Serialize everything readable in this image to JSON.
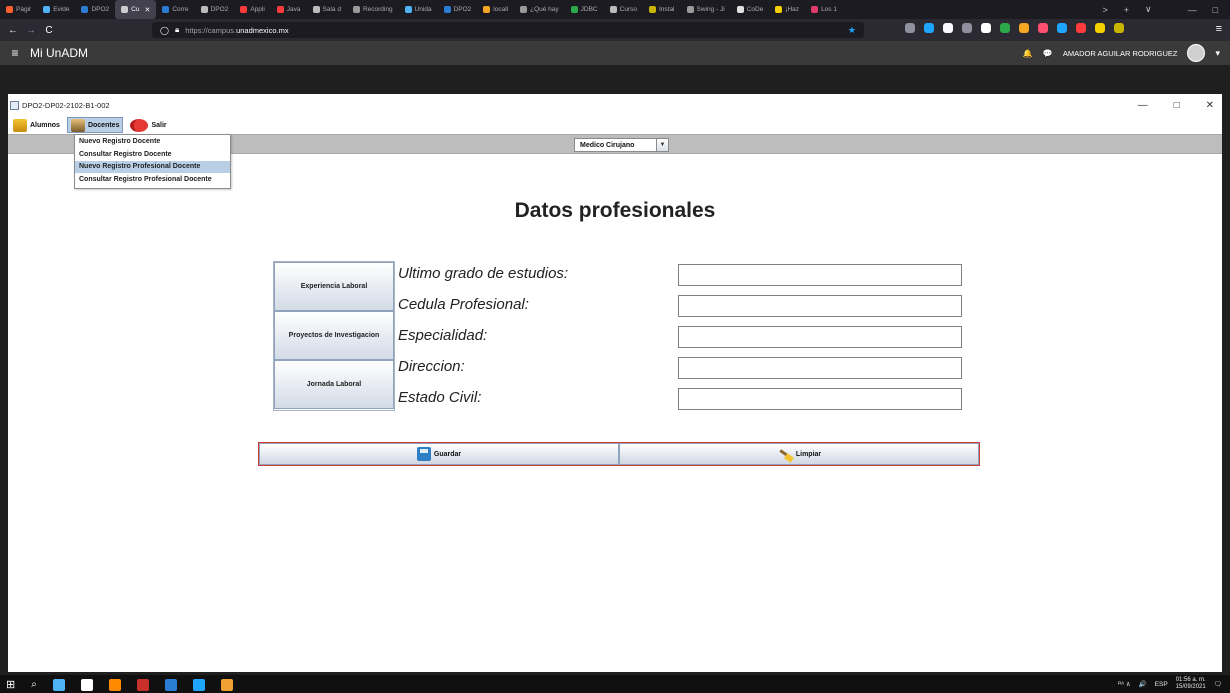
{
  "browser": {
    "tabs": [
      {
        "label": "Págir",
        "color": "#ff5f2e"
      },
      {
        "label": "Evide",
        "color": "#4fb3f6"
      },
      {
        "label": "DPO2",
        "color": "#2b7cd3"
      },
      {
        "label": "Cu",
        "color": "#cccccc",
        "active": true
      },
      {
        "label": "Corre",
        "color": "#2b7cd3"
      },
      {
        "label": "DPO2",
        "color": "#bbbbbb"
      },
      {
        "label": "Appli",
        "color": "#ff3b3b"
      },
      {
        "label": "Java",
        "color": "#ff3b3b"
      },
      {
        "label": "Sala d",
        "color": "#bbbbbb"
      },
      {
        "label": "Recording",
        "color": "#9a9a9a"
      },
      {
        "label": "Unida",
        "color": "#4fb3f6"
      },
      {
        "label": "DPO2",
        "color": "#2b7cd3"
      },
      {
        "label": "locall",
        "color": "#f5a623"
      },
      {
        "label": "¿Qué hay",
        "color": "#9a9a9a"
      },
      {
        "label": "JDBC",
        "color": "#2aa84a"
      },
      {
        "label": "Curso",
        "color": "#bbbbbb"
      },
      {
        "label": "Instal",
        "color": "#c9b400"
      },
      {
        "label": "Swing - Ji",
        "color": "#9a9a9a"
      },
      {
        "label": "CoDe",
        "color": "#e0e0e0"
      },
      {
        "label": "¡Haz",
        "color": "#f5d000"
      },
      {
        "label": "Los 1",
        "color": "#e03b6a"
      }
    ],
    "url_domain_main": "https://campus.",
    "url_domain_highlight": "unadmexico.mx",
    "icons": {
      "back": "←",
      "forward": "→",
      "reload": "C",
      "bookmark": "★",
      "more": "≡",
      "new_tab": "+",
      "scroll_tabs": ">",
      "tab_list": "∨",
      "minimize": "—",
      "restore": "□"
    },
    "extensions": [
      "#8f8f9d",
      "#1ea5ff",
      "#fbfbfe",
      "#8f8f9d",
      "#ffffff",
      "#2aa84a",
      "#f5a623",
      "#ff4f6e",
      "#1ea5ff",
      "#ff3b3b",
      "#f5d000",
      "#c9b400"
    ]
  },
  "site": {
    "title": "Mi UnADM",
    "user_name": "AMADOR AGUILAR RODRIGUEZ",
    "icons": {
      "hamburger": "≡",
      "bell": "🔔",
      "chat": "💬",
      "caret": "▾"
    }
  },
  "window": {
    "title": "DPO2-DP02-2102-B1-002",
    "controls": {
      "minimize": "—",
      "maximize": "□",
      "close": "✕"
    }
  },
  "menu": {
    "items": [
      {
        "label": "Alumnos"
      },
      {
        "label": "Docentes"
      },
      {
        "label": "Salir"
      }
    ],
    "dropdown": [
      "Nuevo Registro Docente",
      "Consultar Registro Docente",
      "Nuevo Registro Profesional Docente",
      "Consultar Registro Profesional Docente"
    ]
  },
  "toolbar": {
    "combo_value": "Medico Cirujano",
    "combo_arrow": "▼"
  },
  "main": {
    "heading": "Datos profesionales",
    "side_buttons": [
      "Experiencia Laboral",
      "Proyectos de Investigacion",
      "Jornada Laboral"
    ],
    "fields": [
      {
        "label": "Ultimo grado de estudios:",
        "value": ""
      },
      {
        "label": "Cedula Profesional:",
        "value": ""
      },
      {
        "label": "Especialidad:",
        "value": ""
      },
      {
        "label": "Direccion:",
        "value": ""
      },
      {
        "label": "Estado Civil:",
        "value": ""
      }
    ],
    "save_label": "Guardar",
    "clear_label": "Limpiar"
  },
  "taskbar": {
    "apps": [
      "#4fb3f6",
      "#ffffff",
      "#ff8a00",
      "#c9302c",
      "#2b7cd3",
      "#1ea5ff",
      "#f0a030"
    ],
    "language": "ESP",
    "time": "01:56 a. m.",
    "date": "15/09/2021",
    "tray_text": "ᴿᴬ ∧",
    "icons": {
      "start": "⊞",
      "search": "⌕",
      "volume": "🔊",
      "notifications": "🗨"
    }
  }
}
